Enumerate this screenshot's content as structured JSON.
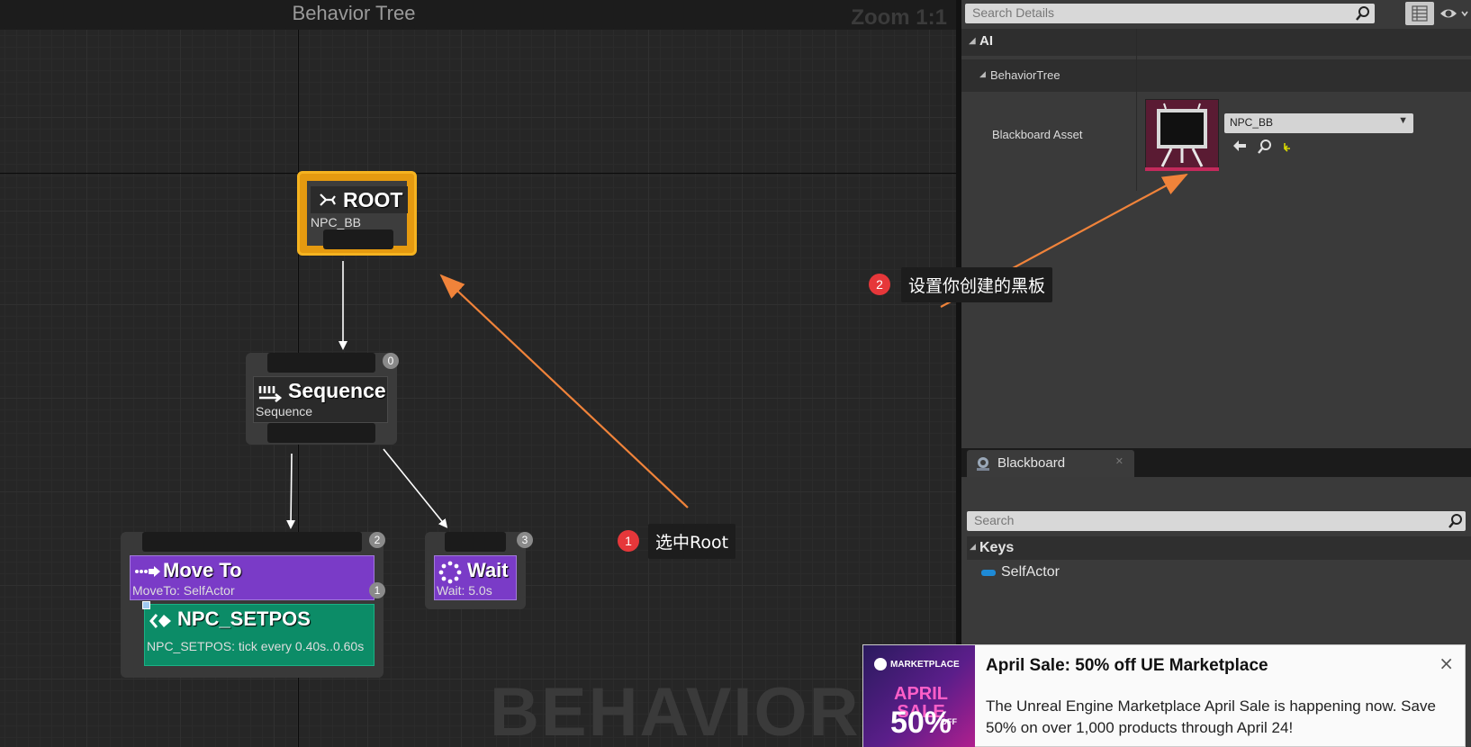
{
  "graph": {
    "title": "Behavior Tree",
    "zoom": "Zoom 1:1",
    "watermark": "BEHAVIOR TR"
  },
  "nodes": {
    "root": {
      "title": "ROOT",
      "subtitle": "NPC_BB"
    },
    "sequence": {
      "title": "Sequence",
      "subtitle": "Sequence",
      "index": "0"
    },
    "move_to": {
      "title": "Move To",
      "subtitle": "MoveTo: SelfActor",
      "index": "2",
      "service_index": "1"
    },
    "service": {
      "title": "NPC_SETPOS",
      "subtitle": "NPC_SETPOS: tick every 0.40s..0.60s"
    },
    "wait": {
      "title": "Wait",
      "subtitle": "Wait: 5.0s",
      "index": "3"
    }
  },
  "annotations": [
    {
      "number": "1",
      "text": "选中Root"
    },
    {
      "number": "2",
      "text": "设置你创建的黑板"
    }
  ],
  "annotation_color": "#f0833a",
  "details": {
    "search_placeholder": "Search Details",
    "category": "AI",
    "subcategory": "BehaviorTree",
    "property_label": "Blackboard Asset",
    "asset_value": "NPC_BB"
  },
  "blackboard": {
    "tab_label": "Blackboard",
    "search_placeholder": "Search",
    "keys_label": "Keys",
    "keys": [
      "SelfActor"
    ]
  },
  "toast": {
    "promo_brand": "MARKETPLACE",
    "promo_line1": "APRIL SALE",
    "promo_line2": "50%",
    "promo_line3": "OFF",
    "title": "April Sale: 50% off UE Marketplace",
    "body": "The Unreal Engine Marketplace April Sale is happening now. Save 50% on over 1,000 products through April 24!",
    "close": "×"
  }
}
